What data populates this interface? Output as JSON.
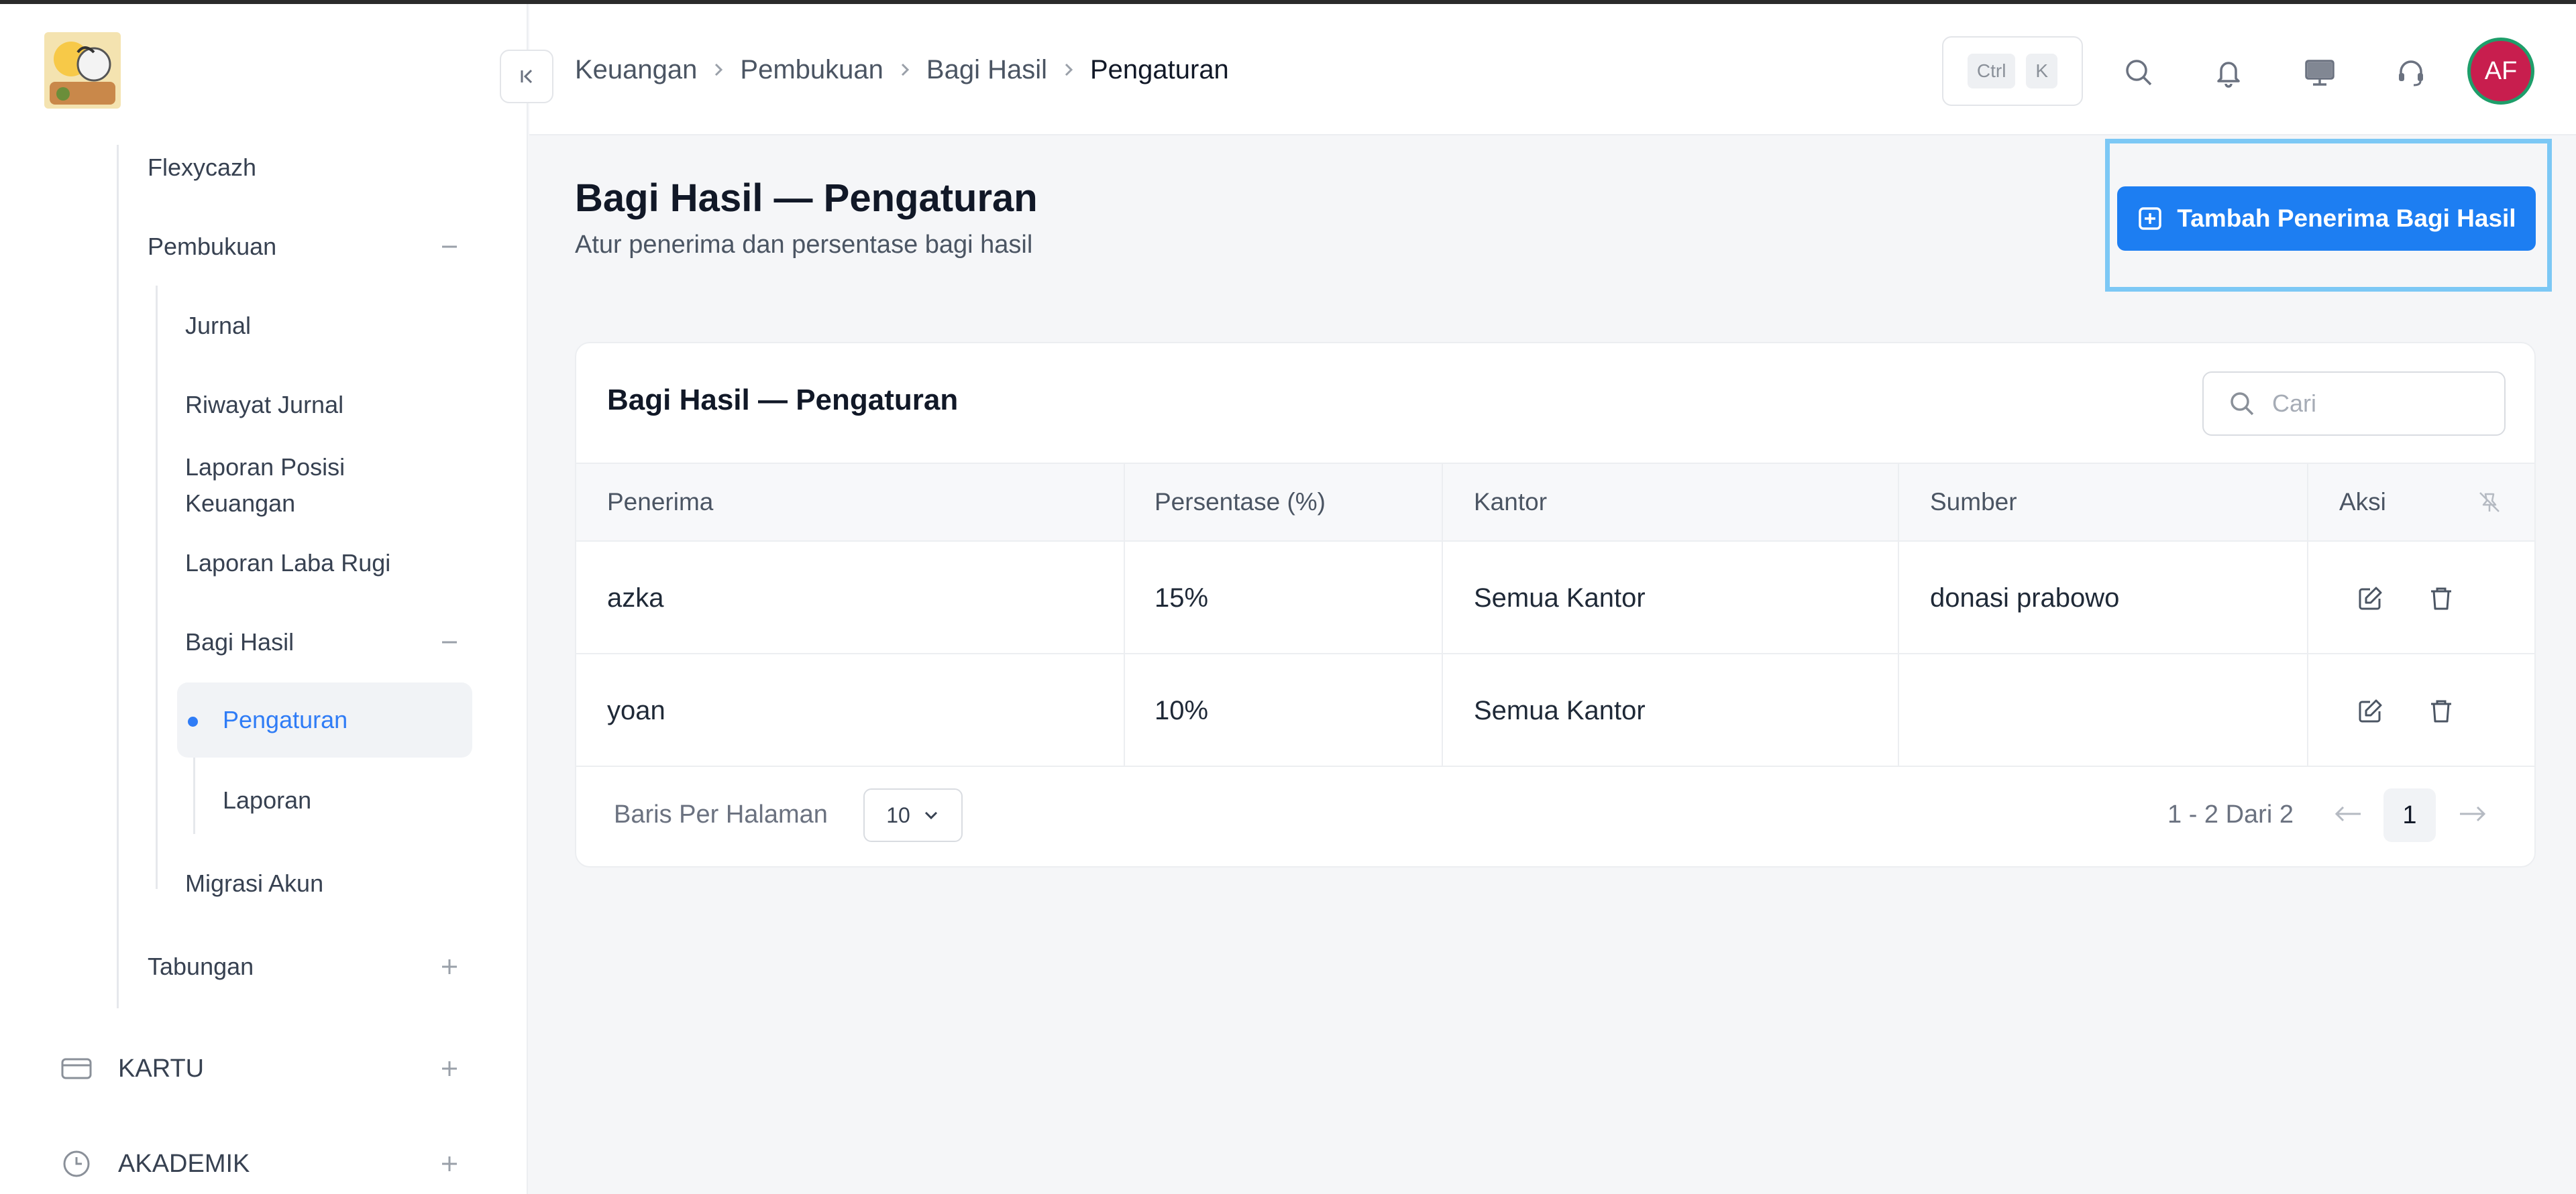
{
  "header": {
    "breadcrumb": [
      "Keuangan",
      "Pembukuan",
      "Bagi Hasil",
      "Pengaturan"
    ],
    "shortcut": {
      "key1": "Ctrl",
      "key2": "K"
    },
    "user_initials": "AF",
    "icons": [
      "search-icon",
      "bell-icon",
      "monitor-icon",
      "headset-icon"
    ]
  },
  "sidebar": {
    "items": {
      "flexycazh": "Flexycazh",
      "pembukuan": "Pembukuan",
      "jurnal": "Jurnal",
      "riwayat_jurnal": "Riwayat Jurnal",
      "laporan_posisi_1": "Laporan Posisi",
      "laporan_posisi_2": "Keuangan",
      "laporan_laba_rugi": "Laporan Laba Rugi",
      "bagi_hasil": "Bagi Hasil",
      "pengaturan": "Pengaturan",
      "laporan": "Laporan",
      "migrasi_akun": "Migrasi Akun",
      "tabungan": "Tabungan",
      "kartu": "KARTU",
      "akademik": "AKADEMIK"
    },
    "active_color": "#2f7cf6"
  },
  "page": {
    "title": "Bagi Hasil — Pengaturan",
    "subtitle": "Atur penerima dan persentase bagi hasil",
    "add_button": "Tambah Penerima Bagi Hasil"
  },
  "table": {
    "title": "Bagi Hasil — Pengaturan",
    "search_placeholder": "Cari",
    "columns": {
      "penerima": "Penerima",
      "persentase": "Persentase (%)",
      "kantor": "Kantor",
      "sumber": "Sumber",
      "aksi": "Aksi"
    },
    "rows": [
      {
        "penerima": "azka",
        "persentase": "15%",
        "kantor": "Semua Kantor",
        "sumber": "donasi prabowo"
      },
      {
        "penerima": "yoan",
        "persentase": "10%",
        "kantor": "Semua Kantor",
        "sumber": ""
      }
    ],
    "footer": {
      "rows_per_page_label": "Baris Per Halaman",
      "rows_per_page": "10",
      "range": "1 - 2 Dari 2",
      "current_page": "1"
    }
  },
  "colors": {
    "primary": "#1d7ef2",
    "highlight": "#7cc8f5",
    "avatar_bg": "#c81e4e",
    "avatar_ring": "#1e9e6a"
  }
}
